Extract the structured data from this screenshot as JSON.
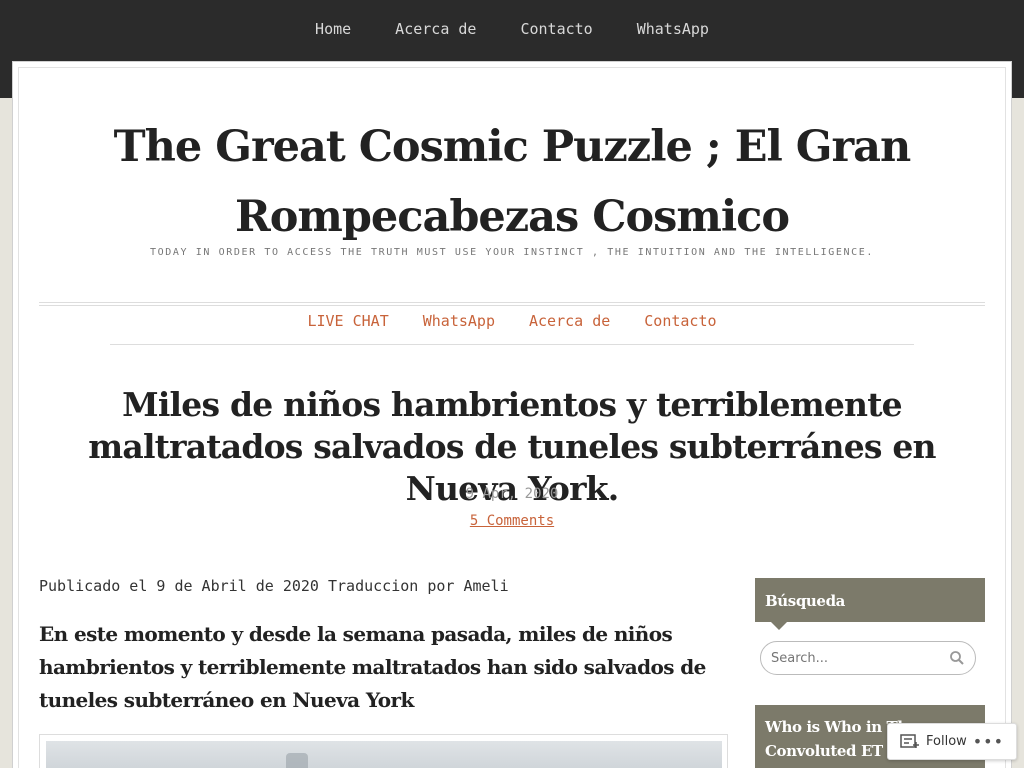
{
  "top_nav": [
    "Home",
    "Acerca de",
    "Contacto",
    "WhatsApp"
  ],
  "site": {
    "title": "The Great Cosmic Puzzle ; El Gran Rompecabezas Cosmico",
    "tagline": "Today in order to access the truth must use your instinct , the intuition and the intelligence."
  },
  "sub_nav": [
    "LIVE CHAT",
    "WhatsApp",
    "Acerca de",
    "Contacto"
  ],
  "post": {
    "title": "Miles de niños hambrientos y terriblemente maltratados salvados de tuneles subterránes en Nueva York.",
    "date": "9 Apr, 2020",
    "comments": "5 Comments",
    "byline": "Publicado el 9 de Abril de 2020 Traduccion por Ameli",
    "lead": "En este momento y desde la semana pasada, miles de niños hambrientos y terriblemente maltratados han sido salvados de tuneles subterráneo en Nueva York"
  },
  "sidebar": {
    "search_title": "Búsqueda",
    "search_placeholder": "Search...",
    "who_title": "Who is Who in The Convoluted ET ra"
  },
  "follow": {
    "label": "Follow",
    "more": "•••"
  },
  "colors": {
    "accent": "#c8633a",
    "widget": "#7c7a6a",
    "topbar": "#2b2b2b"
  },
  "icons": [
    "search-icon",
    "follow-icon",
    "more-icon"
  ]
}
